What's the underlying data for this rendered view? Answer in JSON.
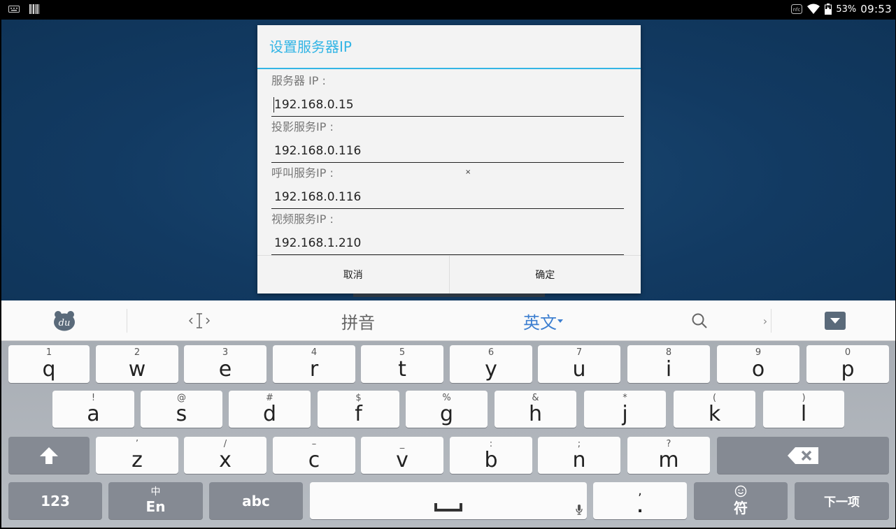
{
  "status": {
    "icons_left": [
      "keyboard-icon",
      "barcode-icon"
    ],
    "icons_right": [
      "nfc-icon",
      "wifi-icon",
      "battery-icon"
    ],
    "battery": "53%",
    "time": "09:53"
  },
  "dialog": {
    "title": "设置服务器IP",
    "fields": [
      {
        "label": "服务器 IP :",
        "value": "192.168.0.15"
      },
      {
        "label": "投影服务IP :",
        "value": "192.168.0.116"
      },
      {
        "label": "呼叫服务IP :",
        "value": "192.168.0.116"
      },
      {
        "label": "视频服务IP :",
        "value": "192.168.1.210"
      }
    ],
    "stray_mark": "×",
    "cancel": "取消",
    "ok": "确定"
  },
  "keyboard": {
    "toolbar": {
      "logo": "du",
      "cursor_icon": "text-cursor-icon",
      "pinyin": "拼音",
      "english": "英文",
      "search_icon": "search-icon",
      "more": "›",
      "hide_icon": "hide-keyboard-icon"
    },
    "row1": [
      {
        "hint": "1",
        "key": "q"
      },
      {
        "hint": "2",
        "key": "w"
      },
      {
        "hint": "3",
        "key": "e"
      },
      {
        "hint": "4",
        "key": "r"
      },
      {
        "hint": "5",
        "key": "t"
      },
      {
        "hint": "6",
        "key": "y"
      },
      {
        "hint": "7",
        "key": "u"
      },
      {
        "hint": "8",
        "key": "i"
      },
      {
        "hint": "9",
        "key": "o"
      },
      {
        "hint": "0",
        "key": "p"
      }
    ],
    "row2": [
      {
        "hint": "!",
        "key": "a"
      },
      {
        "hint": "@",
        "key": "s"
      },
      {
        "hint": "#",
        "key": "d"
      },
      {
        "hint": "$",
        "key": "f"
      },
      {
        "hint": "%",
        "key": "g"
      },
      {
        "hint": "&",
        "key": "h"
      },
      {
        "hint": "*",
        "key": "j"
      },
      {
        "hint": "(",
        "key": "k"
      },
      {
        "hint": ")",
        "key": "l"
      }
    ],
    "row3": [
      {
        "hint": "’",
        "key": "z"
      },
      {
        "hint": "/",
        "key": "x"
      },
      {
        "hint": "–",
        "key": "c"
      },
      {
        "hint": "_",
        "key": "v"
      },
      {
        "hint": ":",
        "key": "b"
      },
      {
        "hint": ";",
        "key": "n"
      },
      {
        "hint": "?",
        "key": "m"
      }
    ],
    "shift_icon": "shift-arrow-icon",
    "backspace_icon": "backspace-icon",
    "num_key": "123",
    "lang_key_top": "中",
    "lang_key_bottom": "En",
    "abc_key": "abc",
    "space_icon": "space-bar-icon",
    "mic_icon": "microphone-icon",
    "punct_top": ",",
    "punct_bottom": ".",
    "emoji_icon": "smiley-icon",
    "symbol_key": "符",
    "next_key": "下一项"
  }
}
